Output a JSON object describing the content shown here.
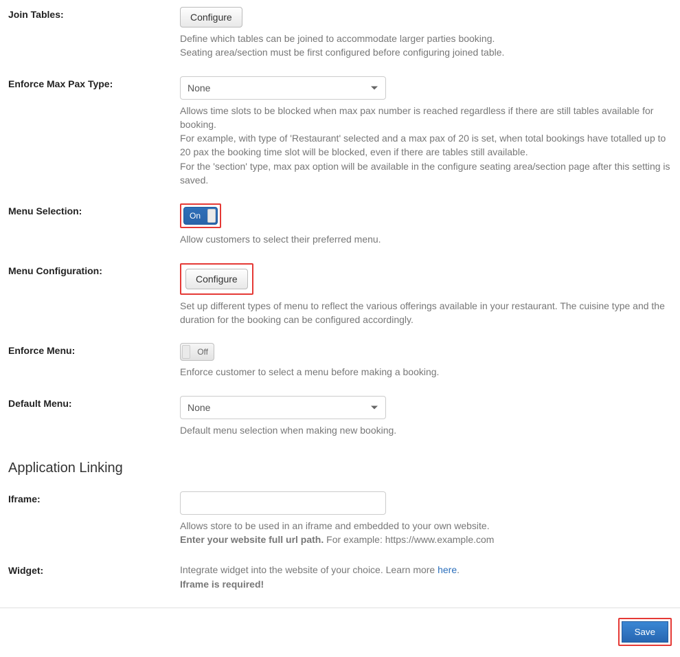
{
  "rows": {
    "join_tables": {
      "label": "Join Tables:",
      "button": "Configure",
      "help1": "Define which tables can be joined to accommodate larger parties booking.",
      "help2": "Seating area/section must be first configured before configuring joined table."
    },
    "enforce_max_pax": {
      "label": "Enforce Max Pax Type:",
      "selected": "None",
      "help1": "Allows time slots to be blocked when max pax number is reached regardless if there are still tables available for booking.",
      "help2": "For example, with type of 'Restaurant' selected and a max pax of 20 is set, when total bookings have totalled up to 20 pax the booking time slot will be blocked, even if there are tables still available.",
      "help3": "For the 'section' type, max pax option will be available in the configure seating area/section page after this setting is saved."
    },
    "menu_selection": {
      "label": "Menu Selection:",
      "toggle_label": "On",
      "help": "Allow customers to select their preferred menu."
    },
    "menu_configuration": {
      "label": "Menu Configuration:",
      "button": "Configure",
      "help": "Set up different types of menu to reflect the various offerings available in your restaurant. The cuisine type and the duration for the booking can be configured accordingly."
    },
    "enforce_menu": {
      "label": "Enforce Menu:",
      "toggle_label": "Off",
      "help": "Enforce customer to select a menu before making a booking."
    },
    "default_menu": {
      "label": "Default Menu:",
      "selected": "None",
      "help": "Default menu selection when making new booking."
    }
  },
  "section": {
    "heading": "Application Linking"
  },
  "iframe": {
    "label": "Iframe:",
    "value": "",
    "help1": "Allows store to be used in an iframe and embedded to your own website.",
    "help2_prefix": "Enter your website full url path.",
    "help2_suffix": " For example: https://www.example.com"
  },
  "widget": {
    "label": "Widget:",
    "help1_prefix": "Integrate widget into the website of your choice. Learn more ",
    "help1_link": "here",
    "help1_suffix": ".",
    "help2": "Iframe is required!"
  },
  "footer": {
    "save": "Save"
  }
}
